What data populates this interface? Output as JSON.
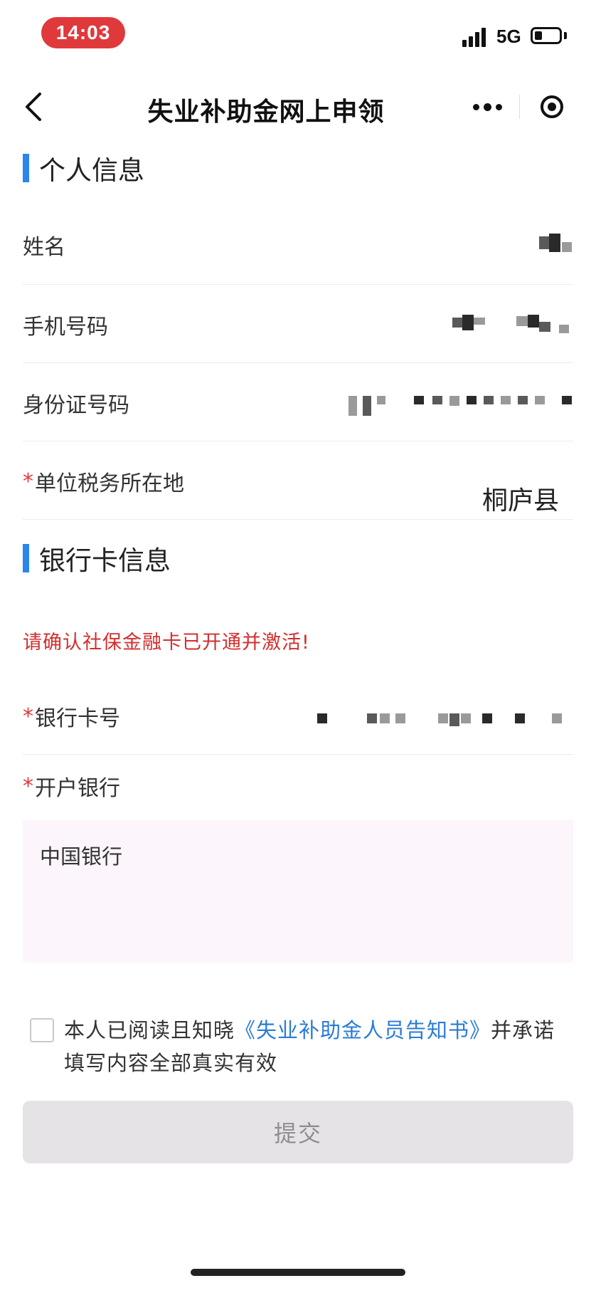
{
  "status_bar": {
    "time": "14:03",
    "network": "5G",
    "battery_level": 0.3
  },
  "nav": {
    "title": "失业补助金网上申领"
  },
  "personal_section": {
    "title": "个人信息",
    "rows": [
      {
        "label": "姓名",
        "required": false
      },
      {
        "label": "手机号码",
        "required": false
      },
      {
        "label": "身份证号码",
        "required": false
      },
      {
        "label": "单位税务所在地",
        "required": true,
        "value": "桐庐县"
      }
    ]
  },
  "bank_section": {
    "title": "银行卡信息",
    "warning": "请确认社保金融卡已开通并激活!",
    "card_label": "银行卡号",
    "bank_label": "开户银行",
    "bank_value": "中国银行"
  },
  "required_mark": "*",
  "agreement": {
    "prefix": "本人已阅读且知晓",
    "link": "《失业补助金人员告知书》",
    "suffix": "并承诺填写内容全部真实有效"
  },
  "submit_label": "提交",
  "colors": {
    "accent": "#2a86e8",
    "warning": "#d42f2f",
    "link": "#2a7bd6",
    "time_pill": "#e0393b"
  }
}
